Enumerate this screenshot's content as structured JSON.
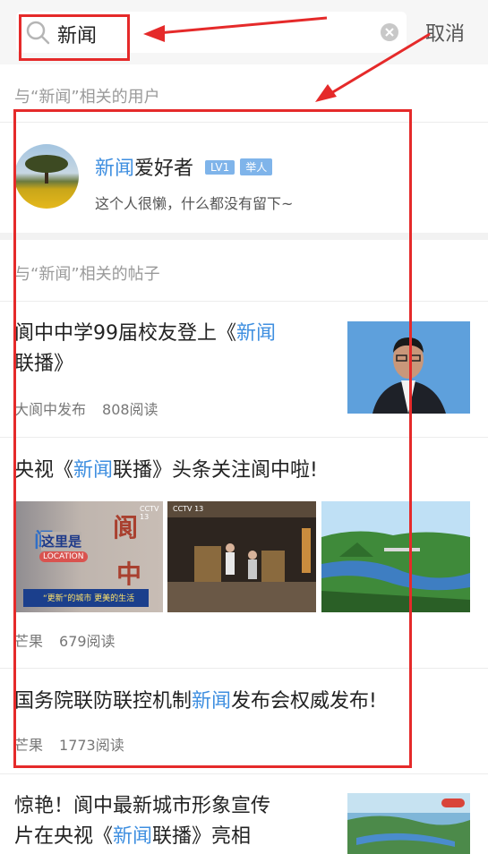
{
  "search": {
    "query": "新闻",
    "cancel_label": "取消"
  },
  "users_section": {
    "title": "与“新闻”相关的用户"
  },
  "user": {
    "name_highlight": "新闻",
    "name_rest": "爱好者",
    "level": "LV1",
    "tag": "举人",
    "bio": "这个人很懒，什么都没有留下~"
  },
  "posts_section": {
    "title": "与“新闻”相关的帖子"
  },
  "posts": [
    {
      "title_pre": "阆中中学99届校友登上《",
      "title_hl": "新闻",
      "title_line2": "联播》",
      "author": "大阆中发布",
      "reads": "808阅读"
    },
    {
      "title_pre": "央视《",
      "title_hl": "新闻",
      "title_post": "联播》头条关注阆中啦!",
      "author": "芒果",
      "reads": "679阅读",
      "thumb1": {
        "headline": "这里是",
        "location": "LOCATION",
        "char1": "阆",
        "char2": "中",
        "channel": "CCTV 13",
        "ticker": "“更新”的城市 更美的生活"
      },
      "thumb2": {
        "channel": "CCTV 13"
      }
    },
    {
      "title_pre": "国务院联防联控机制",
      "title_hl": "新闻",
      "title_post": "发布会权威发布!",
      "author": "芒果",
      "reads": "1773阅读"
    },
    {
      "line1": "惊艳！阆中最新城市形象宣传",
      "line2_pre": "片在央视《",
      "title_hl": "新闻",
      "line2_post": "联播》亮相"
    }
  ],
  "colors": {
    "highlight": "#3f8fe0",
    "annotation": "#e52a2a",
    "badge": "#7fb4ea"
  }
}
